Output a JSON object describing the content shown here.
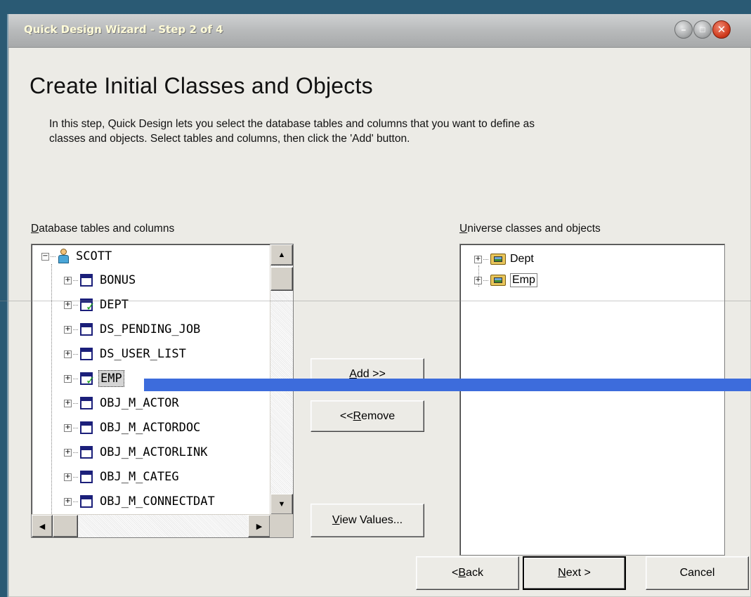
{
  "window": {
    "title": "Quick Design Wizard - Step 2 of 4",
    "controls": {
      "minimize": "–",
      "maximize": "□",
      "close": "✕"
    }
  },
  "page": {
    "heading": "Create Initial Classes and Objects",
    "intro_line1": "In this step, Quick Design lets you select the database tables and columns that you want to define as",
    "intro_line2": "classes and objects. Select tables and columns, then click the 'Add' button."
  },
  "left_panel": {
    "label_accel": "D",
    "label_rest": "atabase tables and columns",
    "root": "SCOTT",
    "items": [
      {
        "label": "BONUS",
        "checked": false,
        "selected": false
      },
      {
        "label": "DEPT",
        "checked": true,
        "selected": false
      },
      {
        "label": "DS_PENDING_JOB",
        "checked": false,
        "selected": false
      },
      {
        "label": "DS_USER_LIST",
        "checked": false,
        "selected": false
      },
      {
        "label": "EMP",
        "checked": true,
        "selected": true
      },
      {
        "label": "OBJ_M_ACTOR",
        "checked": false,
        "selected": false
      },
      {
        "label": "OBJ_M_ACTORDOC",
        "checked": false,
        "selected": false
      },
      {
        "label": "OBJ_M_ACTORLINK",
        "checked": false,
        "selected": false
      },
      {
        "label": "OBJ_M_CATEG",
        "checked": false,
        "selected": false
      },
      {
        "label": "OBJ_M_CONNECTDAT",
        "checked": false,
        "selected": false
      }
    ]
  },
  "right_panel": {
    "label_accel": "U",
    "label_rest": "niverse classes and objects",
    "items": [
      {
        "label": "Dept",
        "selected": false
      },
      {
        "label": "Emp",
        "selected": true
      }
    ]
  },
  "buttons": {
    "add_accel": "A",
    "add_rest": "dd >>",
    "remove_pre": "<< ",
    "remove_accel": "R",
    "remove_rest": "emove",
    "view_accel": "V",
    "view_rest": "iew Values...",
    "back_pre": "< ",
    "back_accel": "B",
    "back_rest": "ack",
    "next_accel": "N",
    "next_rest": "ext >",
    "cancel": "Cancel"
  },
  "icons": {
    "table": "table-icon",
    "checked_table": "checked-table-icon",
    "user": "user-icon",
    "class_folder": "class-folder-icon"
  },
  "colors": {
    "desktop": "#2a5a74",
    "dialog": "#ecebe6",
    "table_icon": "#1b1f7a",
    "check": "#1aa41a",
    "overlay_line": "#3d6cdc"
  }
}
